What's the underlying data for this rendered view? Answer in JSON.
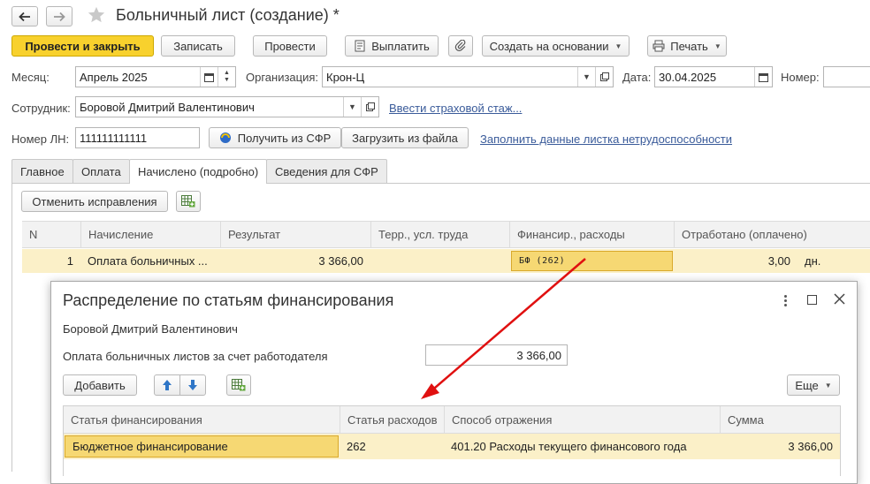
{
  "window": {
    "title": "Больничный лист (создание) *"
  },
  "toolbar": {
    "post_close": "Провести и закрыть",
    "save": "Записать",
    "post": "Провести",
    "pay": "Выплатить",
    "create_based": "Создать на основании",
    "print": "Печать"
  },
  "form": {
    "month_label": "Месяц:",
    "month_value": "Апрель 2025",
    "org_label": "Организация:",
    "org_value": "Крон-Ц",
    "date_label": "Дата:",
    "date_value": "30.04.2025",
    "number_label": "Номер:",
    "number_value": "",
    "employee_label": "Сотрудник:",
    "employee_value": "Боровой Дмитрий Валентинович",
    "insurance_link": "Ввести страховой стаж...",
    "ln_label": "Номер ЛН:",
    "ln_value": "111111111111",
    "get_sfr": "Получить из СФР",
    "load_file": "Загрузить из файла",
    "fill_link": "Заполнить данные листка нетрудоспособности"
  },
  "tabs": [
    {
      "label": "Главное"
    },
    {
      "label": "Оплата"
    },
    {
      "label": "Начислено (подробно)"
    },
    {
      "label": "Сведения для СФР"
    }
  ],
  "tab_content": {
    "cancel_corrections": "Отменить исправления"
  },
  "accrual_table": {
    "columns": [
      "N",
      "Начисление",
      "Результат",
      "Терр., усл. труда",
      "Финансир., расходы",
      "Отработано (оплачено)"
    ],
    "rows": [
      {
        "n": "1",
        "accrual": "Оплата больничных ...",
        "result": "3 366,00",
        "territory": "",
        "financing": "БФ (262)",
        "worked": "3,00",
        "unit": "дн."
      }
    ]
  },
  "popup": {
    "title": "Распределение по статьям финансирования",
    "employee": "Боровой Дмитрий Валентинович",
    "payment_label": "Оплата больничных листов за счет работодателя",
    "payment_value": "3 366,00",
    "add": "Добавить",
    "more": "Еще",
    "table": {
      "columns": [
        "Статья финансирования",
        "Статья расходов",
        "Способ отражения",
        "Сумма"
      ],
      "rows": [
        {
          "article": "Бюджетное финансирование",
          "expense": "262",
          "method": "401.20 Расходы текущего финансового года",
          "amount": "3 366,00"
        }
      ]
    }
  },
  "colors": {
    "primary_button": "#f8d12d",
    "selected_row": "#fbf0c8",
    "selected_cell": "#f6d873",
    "link": "#3a5b9a",
    "arrow": "#e01010"
  }
}
